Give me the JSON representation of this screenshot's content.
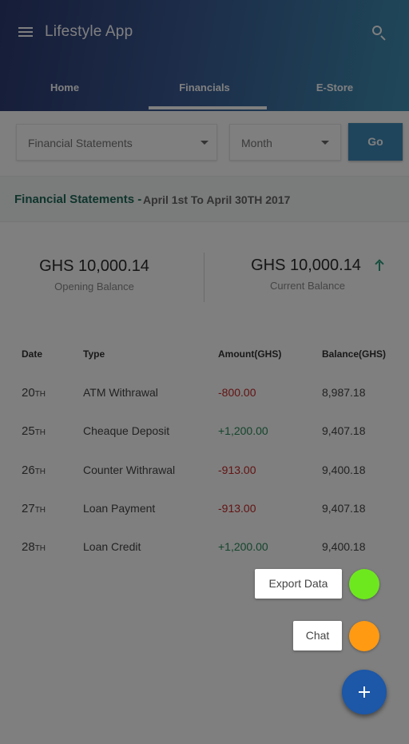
{
  "app": {
    "title": "Lifestyle App"
  },
  "tabs": [
    {
      "label": "Home"
    },
    {
      "label": "Financials"
    },
    {
      "label": "E-Store"
    }
  ],
  "filters": {
    "statement_select": "Financial Statements",
    "month_select": "Month",
    "go_label": "Go"
  },
  "statement": {
    "title": "Financial Statements -",
    "period": "April 1st To April 30TH 2017"
  },
  "balances": {
    "opening": {
      "amount": "GHS 10,000.14",
      "label": "Opening Balance"
    },
    "current": {
      "amount": "GHS 10,000.14",
      "label": "Current Balance",
      "trend_icon": "arrow-up-icon"
    }
  },
  "table": {
    "headers": {
      "date": "Date",
      "type": "Type",
      "amount": "Amount(GHS)",
      "balance": "Balance(GHS)"
    },
    "rows": [
      {
        "day": "20",
        "suffix": "TH",
        "type": "ATM Withrawal",
        "amount": "-800.00",
        "balance": "8,987.18"
      },
      {
        "day": "25",
        "suffix": "TH",
        "type": "Cheaque Deposit",
        "amount": "+1,200.00",
        "balance": "9,407.18"
      },
      {
        "day": "26",
        "suffix": "TH",
        "type": "Counter Withrawal",
        "amount": "-913.00",
        "balance": "9,400.18"
      },
      {
        "day": "27",
        "suffix": "TH",
        "type": "Loan Payment",
        "amount": "-913.00",
        "balance": "9,407.18"
      },
      {
        "day": "28",
        "suffix": "TH",
        "type": "Loan Credit",
        "amount": "+1,200.00",
        "balance": "9,400.18"
      }
    ]
  },
  "speed_dial": {
    "export_label": "Export Data",
    "chat_label": "Chat",
    "export_color": "#6ee81e",
    "chat_color": "#ff9a12",
    "fab_icon": "plus-icon"
  },
  "colors": {
    "header_start": "#2c3a70",
    "header_end": "#3f90b4",
    "accent": "#3f8ab8",
    "negative": "#c62828",
    "positive": "#2a8a5a",
    "fab": "#1c57a8"
  }
}
